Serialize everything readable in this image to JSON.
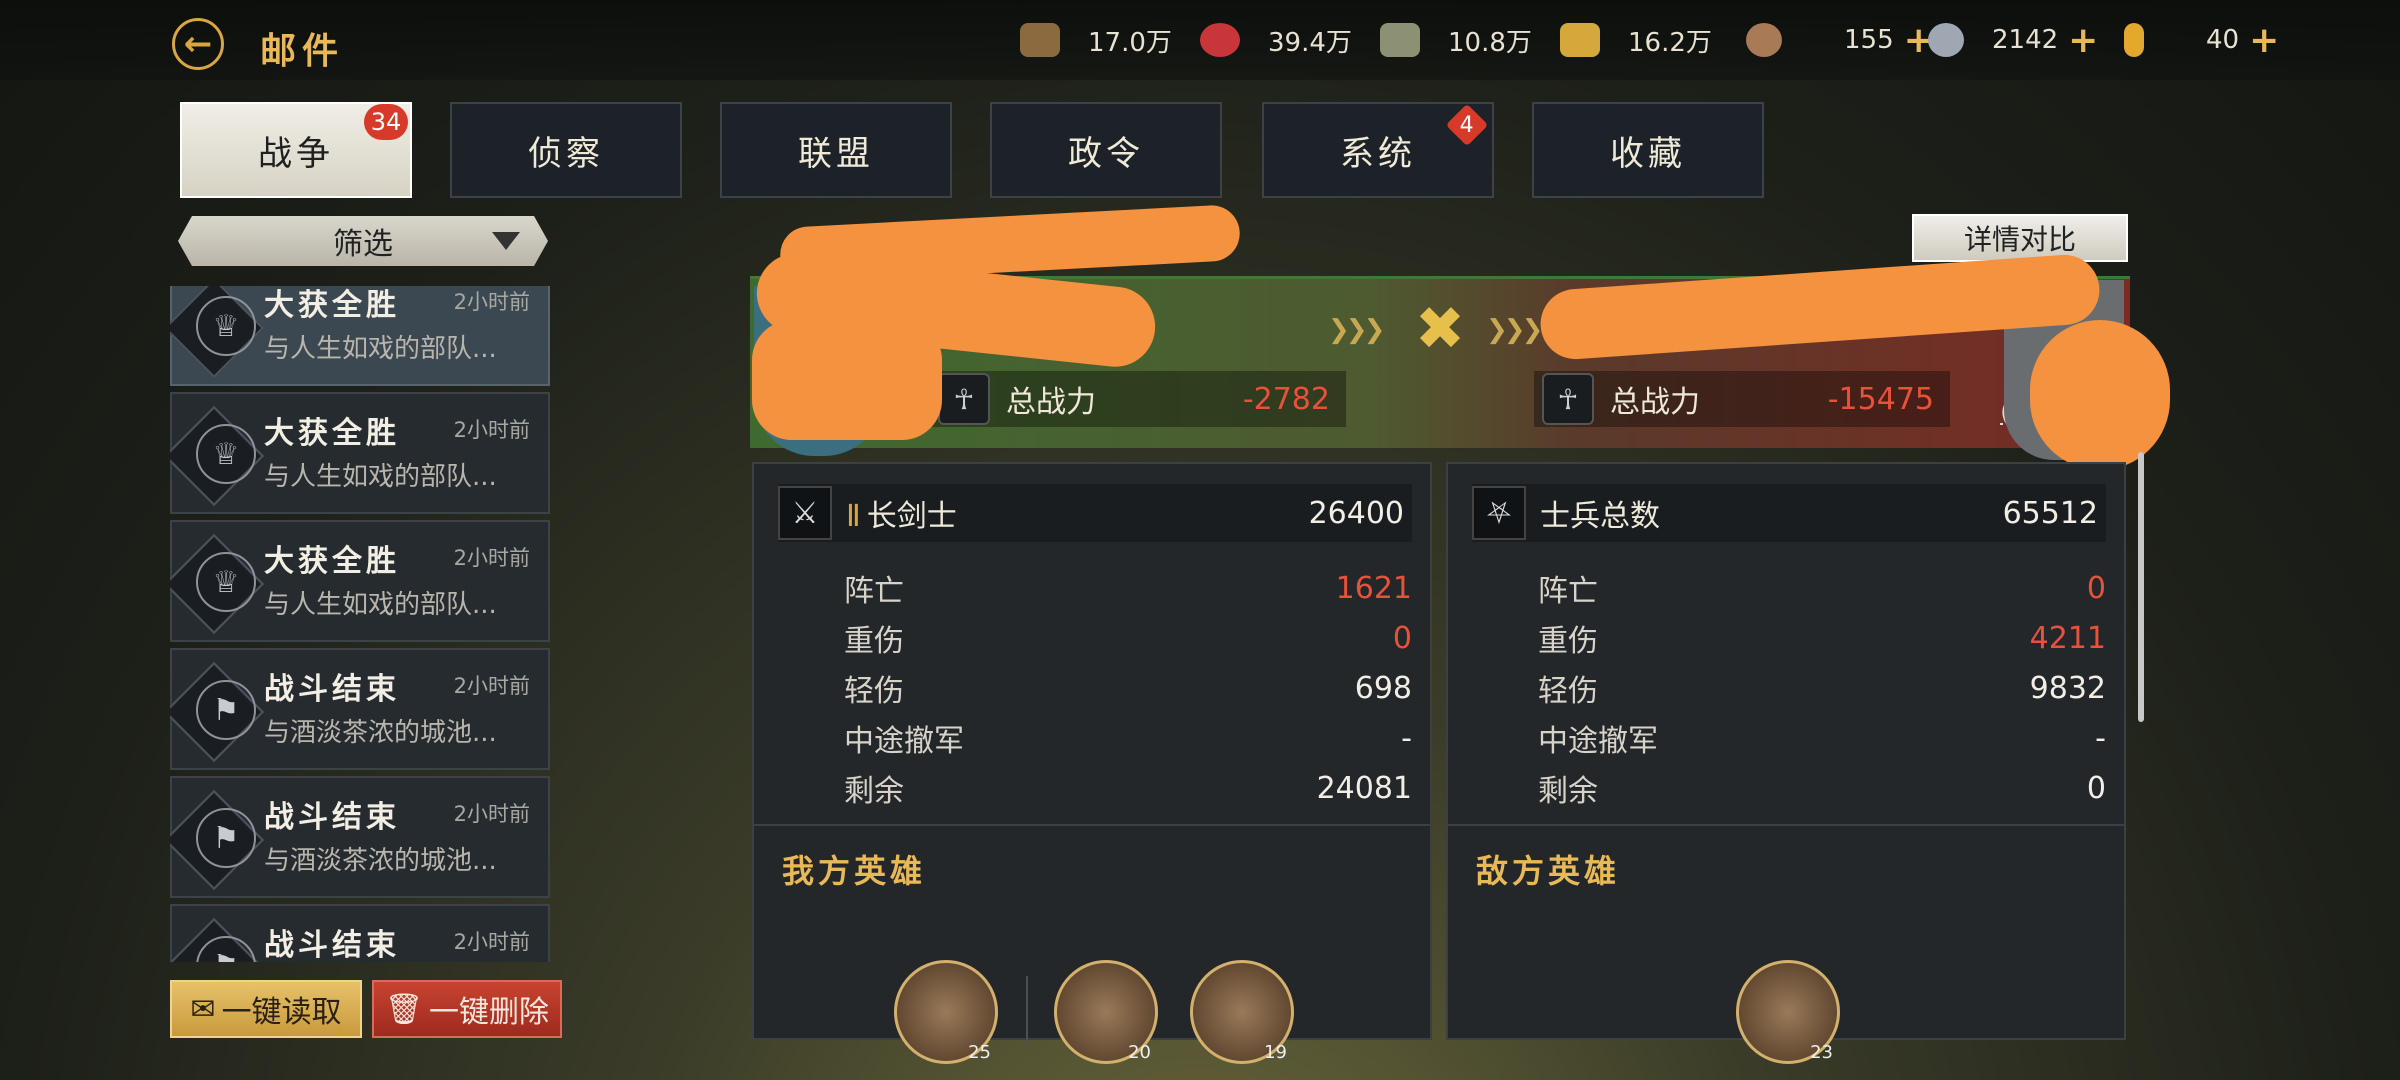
{
  "header": {
    "title": "邮件"
  },
  "resources": [
    {
      "icon": "wood-icon",
      "value": "17.0万",
      "color": "#8a6a3e"
    },
    {
      "icon": "meat-icon",
      "value": "39.4万",
      "color": "#c8363a"
    },
    {
      "icon": "stone-icon",
      "value": "10.8万",
      "color": "#8c9174"
    },
    {
      "icon": "gold-bar-icon",
      "value": "16.2万",
      "color": "#d4a83a"
    },
    {
      "icon": "bronze-coin-icon",
      "value": "155",
      "color": "#a87a55",
      "plus": "+"
    },
    {
      "icon": "silver-coin-icon",
      "value": "2142",
      "color": "#9ea7b2",
      "plus": "+"
    },
    {
      "icon": "gem-icon",
      "value": "40",
      "color": "#e3a82c",
      "plus": "+"
    }
  ],
  "tabs": [
    {
      "label": "战争",
      "badge": "34"
    },
    {
      "label": "侦察"
    },
    {
      "label": "联盟"
    },
    {
      "label": "政令"
    },
    {
      "label": "系统",
      "badge": "4"
    },
    {
      "label": "收藏"
    }
  ],
  "filter": {
    "label": "筛选"
  },
  "mails": [
    {
      "title": "大获全胜",
      "time": "2小时前",
      "subtitle": "与人生如戏的部队..."
    },
    {
      "title": "大获全胜",
      "time": "2小时前",
      "subtitle": "与人生如戏的部队..."
    },
    {
      "title": "大获全胜",
      "time": "2小时前",
      "subtitle": "与人生如戏的部队..."
    },
    {
      "title": "战斗结束",
      "time": "2小时前",
      "subtitle": "与酒淡茶浓的城池..."
    },
    {
      "title": "战斗结束",
      "time": "2小时前",
      "subtitle": "与酒淡茶浓的城池..."
    },
    {
      "title": "战斗结束",
      "time": "2小时前",
      "subtitle": ""
    }
  ],
  "buttons": {
    "read_all": "一键读取",
    "delete_all": "一键删除",
    "compare": "详情对比"
  },
  "battle": {
    "left_power_label": "总战力",
    "left_power_value": "-2782",
    "right_power_label": "总战力",
    "right_power_value": "-15475",
    "right_partial_text": "(2"
  },
  "ally": {
    "rank": "Ⅱ",
    "unit": "长剑士",
    "total": "26400",
    "rows": [
      {
        "label": "阵亡",
        "value": "1621",
        "red": true
      },
      {
        "label": "重伤",
        "value": "0",
        "red": true
      },
      {
        "label": "轻伤",
        "value": "698"
      },
      {
        "label": "中途撤军",
        "value": "-"
      },
      {
        "label": "剩余",
        "value": "24081"
      }
    ],
    "heroes_title": "我方英雄",
    "heroes": [
      {
        "level": "25"
      },
      {
        "level": "20"
      },
      {
        "level": "19"
      }
    ]
  },
  "enemy": {
    "unit": "士兵总数",
    "total": "65512",
    "rows": [
      {
        "label": "阵亡",
        "value": "0",
        "red": true
      },
      {
        "label": "重伤",
        "value": "4211",
        "red": true
      },
      {
        "label": "轻伤",
        "value": "9832"
      },
      {
        "label": "中途撤军",
        "value": "-"
      },
      {
        "label": "剩余",
        "value": "0"
      }
    ],
    "heroes_title": "敌方英雄",
    "heroes": [
      {
        "level": "23"
      }
    ]
  }
}
